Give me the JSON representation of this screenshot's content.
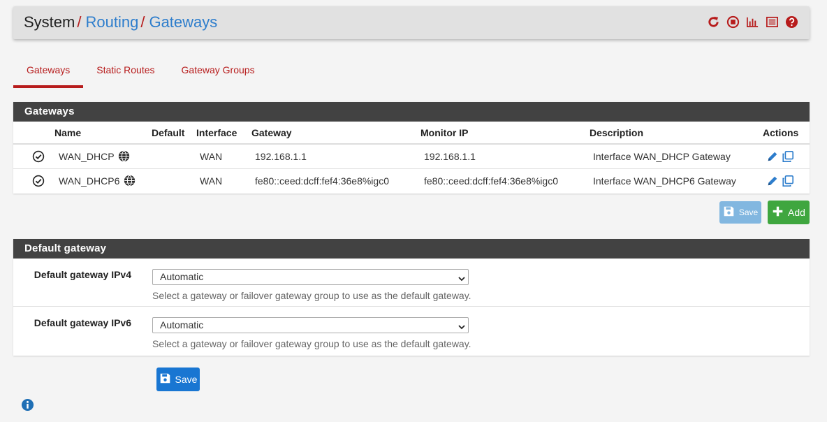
{
  "breadcrumb": {
    "root": "System",
    "sep": "/",
    "routing": "Routing",
    "current": "Gateways"
  },
  "header_icons": [
    "reload-icon",
    "stop-icon",
    "chart-icon",
    "log-icon",
    "help-icon"
  ],
  "tabs": [
    {
      "label": "Gateways",
      "active": true
    },
    {
      "label": "Static Routes",
      "active": false
    },
    {
      "label": "Gateway Groups",
      "active": false
    }
  ],
  "gateways_panel": {
    "title": "Gateways",
    "columns": [
      "Name",
      "Default",
      "Interface",
      "Gateway",
      "Monitor IP",
      "Description",
      "Actions"
    ],
    "rows": [
      {
        "name": "WAN_DHCP",
        "default": "",
        "interface": "WAN",
        "gateway": "192.168.1.1",
        "monitor_ip": "192.168.1.1",
        "description": "Interface WAN_DHCP Gateway"
      },
      {
        "name": "WAN_DHCP6",
        "default": "",
        "interface": "WAN",
        "gateway": "fe80::ceed:dcff:fef4:36e8%igc0",
        "monitor_ip": "fe80::ceed:dcff:fef4:36e8%igc0",
        "description": "Interface WAN_DHCP6 Gateway"
      }
    ]
  },
  "buttons": {
    "save_top": "Save",
    "add": "Add",
    "save_bottom": "Save"
  },
  "default_gateway_panel": {
    "title": "Default gateway",
    "ipv4": {
      "label": "Default gateway IPv4",
      "value": "Automatic",
      "help": "Select a gateway or failover gateway group to use as the default gateway."
    },
    "ipv6": {
      "label": "Default gateway IPv6",
      "value": "Automatic",
      "help": "Select a gateway or failover gateway group to use as the default gateway."
    }
  },
  "colors": {
    "accent_red": "#b71c1c",
    "link_blue": "#2d7dcc",
    "panel_heading": "#424242",
    "add_green": "#3fa63f",
    "save_blue": "#1976d2",
    "save_disabled": "#82b7e0"
  }
}
